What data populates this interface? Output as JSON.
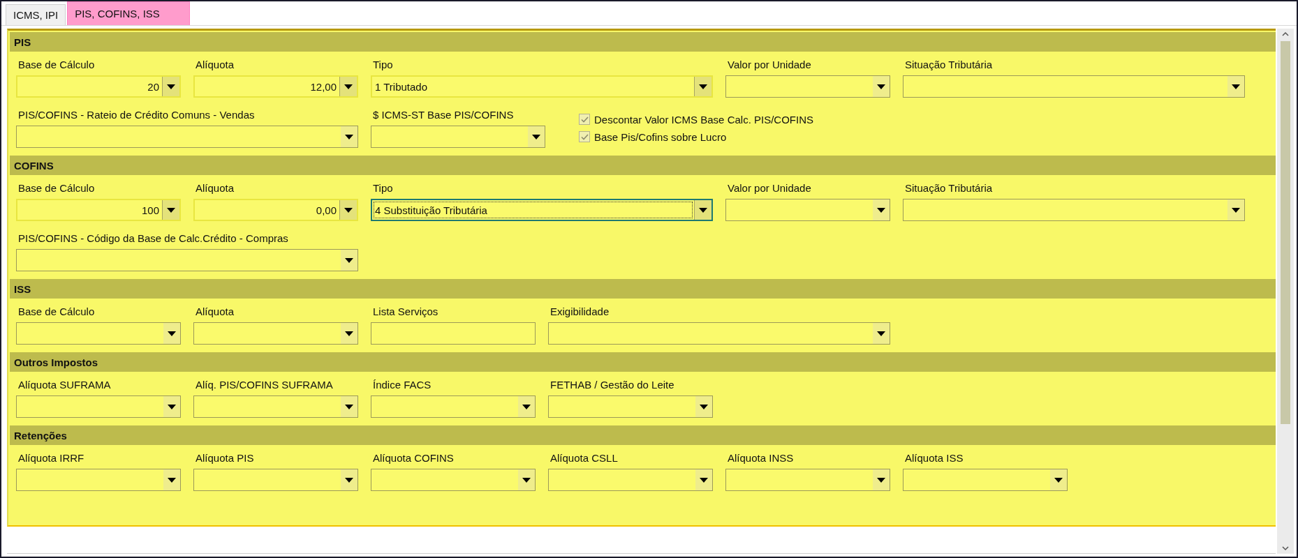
{
  "tabs": [
    {
      "label": "ICMS, IPI",
      "selected": false
    },
    {
      "label": "PIS, COFINS, ISS",
      "selected": true
    }
  ],
  "sections": [
    {
      "title": "PIS",
      "lines": [
        {
          "fields": [
            {
              "kind": "number",
              "label": "Base de Cálculo",
              "value": "20",
              "focused": false
            },
            {
              "kind": "number",
              "label": "Alíquota",
              "value": "12,00",
              "focused": false
            },
            {
              "kind": "combo",
              "label": "Tipo",
              "value": "1 Tributado",
              "focused": false
            },
            {
              "kind": "combo",
              "label": "Valor por Unidade",
              "focused": false
            },
            {
              "kind": "combo",
              "label": "Situação Tributária",
              "focused": false
            }
          ]
        },
        {
          "fields": [
            {
              "kind": "combo",
              "label": "PIS/COFINS - Rateio de Crédito Comuns - Vendas",
              "focused": false
            },
            {
              "kind": "combo",
              "label": "$ ICMS-ST Base PIS/COFINS",
              "focused": false
            },
            {
              "kind": "checkgroup",
              "items": [
                {
                  "label": "Descontar Valor ICMS Base Calc. PIS/COFINS",
                  "checked": true
                },
                {
                  "label": "Base Pis/Cofins sobre Lucro",
                  "checked": true
                }
              ]
            }
          ]
        }
      ]
    },
    {
      "title": "COFINS",
      "lines": [
        {
          "fields": [
            {
              "kind": "number",
              "label": "Base de Cálculo",
              "value": "100",
              "focused": false
            },
            {
              "kind": "number",
              "label": "Alíquota",
              "value": "0,00",
              "focused": false
            },
            {
              "kind": "combo",
              "label": "Tipo",
              "value": "4 Substituição Tributária",
              "focused": true
            },
            {
              "kind": "combo",
              "label": "Valor por Unidade",
              "focused": false
            },
            {
              "kind": "combo",
              "label": "Situação Tributária",
              "focused": false
            }
          ]
        },
        {
          "fields": [
            {
              "kind": "combo",
              "label": "PIS/COFINS - Código da Base de Calc.Crédito - Compras",
              "focused": false
            }
          ]
        }
      ]
    },
    {
      "title": "ISS",
      "lines": [
        {
          "fields": [
            {
              "kind": "combo",
              "label": "Base de Cálculo",
              "focused": false
            },
            {
              "kind": "combo",
              "label": "Alíquota",
              "focused": false
            },
            {
              "kind": "text",
              "label": "Lista Serviços",
              "focused": false
            },
            {
              "kind": "combo",
              "label": "Exigibilidade",
              "focused": false
            }
          ]
        }
      ]
    },
    {
      "title": "Outros Impostos",
      "lines": [
        {
          "fields": [
            {
              "kind": "combo",
              "label": "Alíquota SUFRAMA",
              "focused": false
            },
            {
              "kind": "combo",
              "label": "Alíq. PIS/COFINS SUFRAMA",
              "focused": false
            },
            {
              "kind": "combo",
              "label": "Índice FACS",
              "focused": false
            },
            {
              "kind": "combo",
              "label": "FETHAB / Gestão do Leite",
              "focused": false
            }
          ]
        }
      ]
    },
    {
      "title": "Retenções",
      "lines": [
        {
          "fields": [
            {
              "kind": "combo",
              "label": "Alíquota IRRF",
              "focused": false
            },
            {
              "kind": "combo",
              "label": "Alíquota PIS",
              "focused": false
            },
            {
              "kind": "combo",
              "label": "Alíquota COFINS",
              "focused": false
            },
            {
              "kind": "combo",
              "label": "Alíquota CSLL",
              "focused": false
            },
            {
              "kind": "combo",
              "label": "Alíquota INSS",
              "focused": false
            },
            {
              "kind": "combo",
              "label": "Alíquota ISS",
              "focused": false
            }
          ]
        }
      ]
    }
  ]
}
